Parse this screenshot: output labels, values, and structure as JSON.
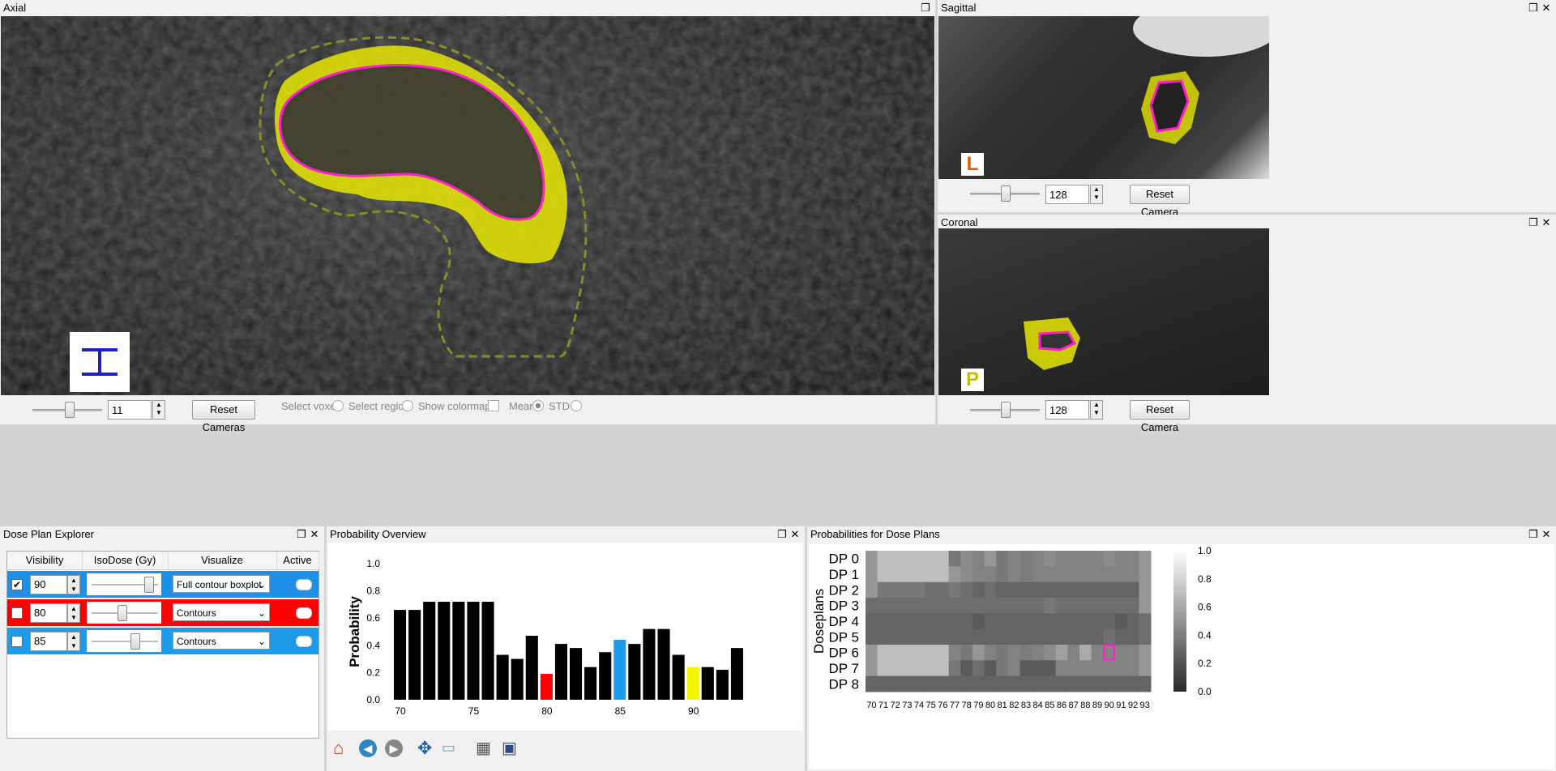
{
  "panels": {
    "axial": {
      "title": "Axial"
    },
    "sagittal": {
      "title": "Sagittal",
      "orientation": "L"
    },
    "coronal": {
      "title": "Coronal",
      "orientation": "P"
    },
    "dose_plan_explorer": {
      "title": "Dose Plan Explorer"
    },
    "probability_overview": {
      "title": "Probability Overview"
    },
    "probabilities_dose_plans": {
      "title": "Probabilities for Dose Plans"
    }
  },
  "axial_controls": {
    "slice_value": "11",
    "slice_fraction": 0.52,
    "reset_label": "Reset Cameras",
    "select_voxel": "Select voxel",
    "select_region": "Select region",
    "show_colormap": "Show colormap",
    "mean": "Mean",
    "std": "STD"
  },
  "sagittal_controls": {
    "slice_value": "128",
    "slice_fraction": 0.5,
    "reset_label": "Reset Camera"
  },
  "coronal_controls": {
    "slice_value": "128",
    "slice_fraction": 0.5,
    "reset_label": "Reset Camera"
  },
  "window_icons": {
    "restore": "restore-icon",
    "close": "close-icon"
  },
  "explorer": {
    "headers": [
      "Visibility",
      "IsoDose (Gy)",
      "Visualize",
      "Active"
    ],
    "rows": [
      {
        "checked": true,
        "value": "90",
        "iso_fraction": 0.85,
        "visualize": "Full contour boxplot",
        "color": "#1e90e8"
      },
      {
        "checked": false,
        "value": "80",
        "iso_fraction": 0.45,
        "visualize": "Contours",
        "color": "#ff0000"
      },
      {
        "checked": false,
        "value": "85",
        "iso_fraction": 0.65,
        "visualize": "Contours",
        "color": "#1e9be8"
      }
    ]
  },
  "toolbar_icons": [
    "home-icon",
    "back-icon",
    "forward-icon",
    "pan-icon",
    "zoom-icon",
    "configure-icon",
    "save-icon"
  ],
  "chart_data": [
    {
      "type": "bar",
      "ylabel": "Probability",
      "ylim": [
        0,
        1.0
      ],
      "yticks": [
        "0.0",
        "0.2",
        "0.4",
        "0.6",
        "0.8",
        "1.0"
      ],
      "xticks": [
        "70",
        "75",
        "80",
        "85",
        "90"
      ],
      "x": [
        70,
        71,
        72,
        73,
        74,
        75,
        76,
        77,
        78,
        79,
        80,
        81,
        82,
        83,
        84,
        85,
        86,
        87,
        88,
        89,
        90,
        91,
        92,
        93
      ],
      "values": [
        0.66,
        0.66,
        0.72,
        0.72,
        0.72,
        0.72,
        0.72,
        0.33,
        0.3,
        0.47,
        0.19,
        0.41,
        0.38,
        0.24,
        0.35,
        0.44,
        0.41,
        0.52,
        0.52,
        0.33,
        0.24,
        0.24,
        0.22,
        0.38
      ],
      "highlights": {
        "80": "#ff0000",
        "85": "#1e9be8",
        "90": "#f4f400"
      }
    },
    {
      "type": "heatmap",
      "ylabel": "Doseplans",
      "rows": [
        "DP 0",
        "DP 1",
        "DP 2",
        "DP 3",
        "DP 4",
        "DP 5",
        "DP 6",
        "DP 7",
        "DP 8"
      ],
      "columns": [
        "70",
        "71",
        "72",
        "73",
        "74",
        "75",
        "76",
        "77",
        "78",
        "79",
        "80",
        "81",
        "82",
        "83",
        "84",
        "85",
        "86",
        "87",
        "88",
        "89",
        "90",
        "91",
        "92",
        "93"
      ],
      "colorbar_ticks": [
        "0.0",
        "0.2",
        "0.4",
        "0.6",
        "0.8",
        "1.0"
      ],
      "selected_cell": {
        "row": "DP 6",
        "column": "90"
      },
      "values": [
        [
          0.55,
          0.75,
          0.75,
          0.75,
          0.75,
          0.75,
          0.75,
          0.4,
          0.5,
          0.45,
          0.55,
          0.4,
          0.45,
          0.42,
          0.45,
          0.5,
          0.45,
          0.45,
          0.45,
          0.45,
          0.5,
          0.45,
          0.45,
          0.55
        ],
        [
          0.55,
          0.75,
          0.75,
          0.75,
          0.75,
          0.75,
          0.75,
          0.55,
          0.5,
          0.45,
          0.45,
          0.4,
          0.45,
          0.42,
          0.45,
          0.45,
          0.45,
          0.45,
          0.45,
          0.45,
          0.45,
          0.45,
          0.45,
          0.55
        ],
        [
          0.55,
          0.4,
          0.4,
          0.4,
          0.4,
          0.35,
          0.35,
          0.4,
          0.35,
          0.3,
          0.35,
          0.3,
          0.3,
          0.3,
          0.3,
          0.3,
          0.3,
          0.3,
          0.3,
          0.3,
          0.3,
          0.3,
          0.3,
          0.55
        ],
        [
          0.35,
          0.35,
          0.35,
          0.35,
          0.35,
          0.35,
          0.35,
          0.35,
          0.35,
          0.35,
          0.35,
          0.35,
          0.35,
          0.35,
          0.35,
          0.4,
          0.35,
          0.35,
          0.35,
          0.35,
          0.35,
          0.35,
          0.35,
          0.55
        ],
        [
          0.3,
          0.3,
          0.3,
          0.3,
          0.3,
          0.3,
          0.3,
          0.3,
          0.3,
          0.25,
          0.3,
          0.3,
          0.3,
          0.3,
          0.3,
          0.3,
          0.3,
          0.3,
          0.3,
          0.3,
          0.3,
          0.25,
          0.3,
          0.35
        ],
        [
          0.3,
          0.3,
          0.3,
          0.3,
          0.3,
          0.3,
          0.3,
          0.3,
          0.3,
          0.3,
          0.3,
          0.3,
          0.3,
          0.3,
          0.3,
          0.3,
          0.3,
          0.3,
          0.3,
          0.3,
          0.35,
          0.3,
          0.3,
          0.35
        ],
        [
          0.55,
          0.75,
          0.75,
          0.75,
          0.75,
          0.75,
          0.75,
          0.45,
          0.4,
          0.55,
          0.45,
          0.4,
          0.45,
          0.42,
          0.45,
          0.5,
          0.6,
          0.45,
          0.65,
          0.45,
          0.45,
          0.45,
          0.45,
          0.55
        ],
        [
          0.55,
          0.75,
          0.75,
          0.75,
          0.75,
          0.75,
          0.75,
          0.4,
          0.25,
          0.35,
          0.25,
          0.4,
          0.45,
          0.25,
          0.25,
          0.25,
          0.45,
          0.45,
          0.45,
          0.45,
          0.45,
          0.45,
          0.45,
          0.55
        ],
        [
          0.3,
          0.3,
          0.3,
          0.3,
          0.3,
          0.3,
          0.3,
          0.3,
          0.3,
          0.3,
          0.3,
          0.3,
          0.3,
          0.3,
          0.3,
          0.3,
          0.3,
          0.3,
          0.3,
          0.3,
          0.3,
          0.3,
          0.3,
          0.3
        ]
      ]
    }
  ]
}
